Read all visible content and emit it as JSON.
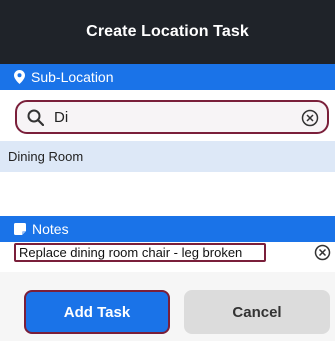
{
  "header": {
    "title": "Create Location Task"
  },
  "sub_location": {
    "section_label": "Sub-Location",
    "section_icon": "location-pin-icon",
    "search": {
      "value": "Di",
      "placeholder": ""
    },
    "results": [
      "Dining Room"
    ]
  },
  "notes": {
    "section_label": "Notes",
    "section_icon": "note-icon",
    "value": "Replace dining room chair - leg broken"
  },
  "actions": {
    "add_label": "Add Task",
    "cancel_label": "Cancel"
  },
  "colors": {
    "header_bg": "#1f2329",
    "section_bg": "#1a73e8",
    "highlight_border": "#7a1f3a",
    "result_bg": "#dde8f7",
    "primary_button": "#1a73e8",
    "secondary_button": "#dcdcdc"
  }
}
